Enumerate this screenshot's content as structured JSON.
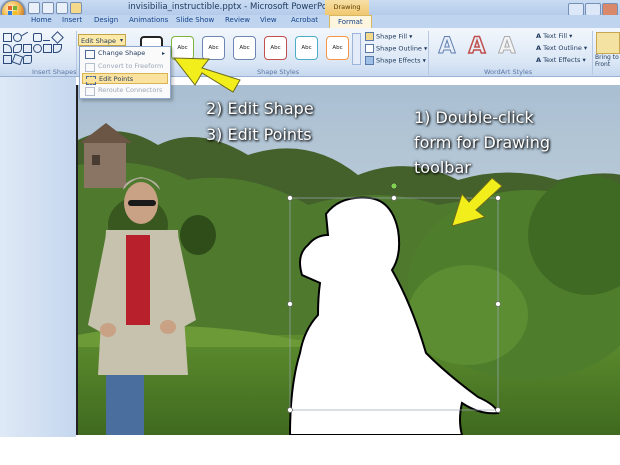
{
  "window": {
    "title": "invisibilia_instructible.pptx - Microsoft PowerPoint",
    "contextual_tab_group": "Drawing Tools"
  },
  "tabs": [
    "Home",
    "Insert",
    "Design",
    "Animations",
    "Slide Show",
    "Review",
    "View",
    "Acrobat",
    "Format"
  ],
  "active_tab": "Format",
  "ribbon": {
    "insert_shapes_label": "Insert Shapes",
    "edit_shape_button": "Edit Shape",
    "shape_styles": {
      "label": "Shape Styles",
      "styles": [
        "Abc",
        "Abc",
        "Abc",
        "Abc",
        "Abc",
        "Abc",
        "Abc"
      ],
      "fill": "Shape Fill",
      "outline": "Shape Outline",
      "effects": "Shape Effects"
    },
    "wordart": {
      "label": "WordArt Styles",
      "text_fill": "Text Fill",
      "text_outline": "Text Outline",
      "text_effects": "Text Effects"
    },
    "arrange": {
      "bring_to_front": "Bring to Front"
    }
  },
  "edit_shape_menu": {
    "items": [
      {
        "label": "Change Shape",
        "enabled": true,
        "submenu": true
      },
      {
        "label": "Convert to Freeform",
        "enabled": false
      },
      {
        "label": "Edit Points",
        "enabled": true,
        "highlighted": true
      },
      {
        "label": "Reroute Connectors",
        "enabled": false
      }
    ]
  },
  "slide": {
    "annotation_left": [
      "2) Edit Shape",
      "3) Edit Points"
    ],
    "annotation_right": [
      "1) Double-click",
      "form for Drawing",
      "toolbar"
    ]
  },
  "colors": {
    "arrow": "#f2ee1c",
    "ribbon_bg": "#dbe7f6",
    "menu_highlight": "#fbe29e",
    "context_tab": "#f1c770"
  }
}
